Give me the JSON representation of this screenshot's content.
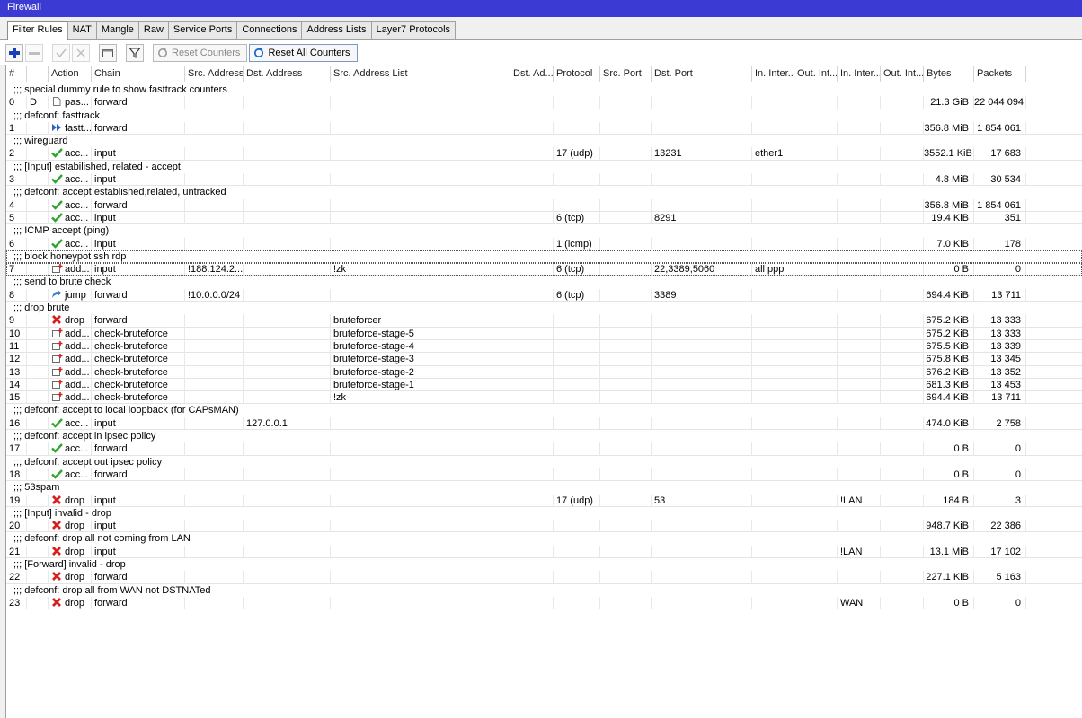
{
  "window": {
    "title": "Firewall"
  },
  "tabs": [
    {
      "label": "Filter Rules",
      "active": true
    },
    {
      "label": "NAT"
    },
    {
      "label": "Mangle"
    },
    {
      "label": "Raw"
    },
    {
      "label": "Service Ports"
    },
    {
      "label": "Connections"
    },
    {
      "label": "Address Lists"
    },
    {
      "label": "Layer7 Protocols"
    }
  ],
  "toolbar": {
    "icons": [
      "add-icon",
      "remove-icon",
      "enable-icon",
      "disable-icon",
      "comment-icon",
      "filter-icon"
    ],
    "reset_counters": "Reset Counters",
    "reset_all_counters": "Reset All Counters"
  },
  "columns": [
    "#",
    "",
    "Action",
    "Chain",
    "Src. Address",
    "Dst. Address",
    "Src. Address List",
    "Dst. Ad...",
    "Protocol",
    "Src. Port",
    "Dst. Port",
    "In. Inter...",
    "Out. Int...",
    "In. Inter...",
    "Out. Int...",
    "Bytes",
    "Packets"
  ],
  "rows": [
    {
      "comment": ";;; special dummy rule to show fasttrack counters"
    },
    {
      "num": "0",
      "flag": "D",
      "icon": "passthrough-icon",
      "action": "pas...",
      "chain": "forward",
      "bytes": "21.3 GiB",
      "packets": "22 044 094"
    },
    {
      "comment": ";;; defconf: fasttrack"
    },
    {
      "num": "1",
      "icon": "fasttrack-icon",
      "action": "fastt...",
      "chain": "forward",
      "bytes": "356.8 MiB",
      "packets": "1 854 061"
    },
    {
      "comment": ";;; wireguard"
    },
    {
      "num": "2",
      "icon": "accept-icon",
      "action": "acc...",
      "chain": "input",
      "proto": "17 (udp)",
      "dport": "13231",
      "inif": "ether1",
      "bytes": "3552.1 KiB",
      "packets": "17 683"
    },
    {
      "comment": ";;; [Input] estabilished, related - accept"
    },
    {
      "num": "3",
      "icon": "accept-icon",
      "action": "acc...",
      "chain": "input",
      "bytes": "4.8 MiB",
      "packets": "30 534"
    },
    {
      "comment": ";;; defconf: accept established,related, untracked"
    },
    {
      "num": "4",
      "icon": "accept-icon",
      "action": "acc...",
      "chain": "forward",
      "bytes": "356.8 MiB",
      "packets": "1 854 061"
    },
    {
      "num": "5",
      "icon": "accept-icon",
      "action": "acc...",
      "chain": "input",
      "proto": "6 (tcp)",
      "dport": "8291",
      "bytes": "19.4 KiB",
      "packets": "351"
    },
    {
      "comment": ";;; ICMP accept (ping)"
    },
    {
      "num": "6",
      "icon": "accept-icon",
      "action": "acc...",
      "chain": "input",
      "proto": "1 (icmp)",
      "bytes": "7.0 KiB",
      "packets": "178"
    },
    {
      "comment": ";;; block honeypot ssh rdp",
      "focus": true
    },
    {
      "num": "7",
      "icon": "add-to-list-icon",
      "action": "add...",
      "chain": "input",
      "src": "!188.124.2...",
      "srclist": "!zk",
      "proto": "6 (tcp)",
      "dport": "22,3389,5060",
      "inif": "all ppp",
      "bytes": "0 B",
      "packets": "0",
      "focus": true
    },
    {
      "comment": ";;; send to brute check"
    },
    {
      "num": "8",
      "icon": "jump-icon",
      "action": "jump",
      "chain": "forward",
      "src": "!10.0.0.0/24",
      "proto": "6 (tcp)",
      "dport": "3389",
      "bytes": "694.4 KiB",
      "packets": "13 711"
    },
    {
      "comment": ";;; drop brute"
    },
    {
      "num": "9",
      "icon": "drop-icon",
      "action": "drop",
      "chain": "forward",
      "srclist": "bruteforcer",
      "bytes": "675.2 KiB",
      "packets": "13 333"
    },
    {
      "num": "10",
      "icon": "add-to-list-icon",
      "action": "add...",
      "chain": "check-bruteforce",
      "srclist": "bruteforce-stage-5",
      "bytes": "675.2 KiB",
      "packets": "13 333"
    },
    {
      "num": "11",
      "icon": "add-to-list-icon",
      "action": "add...",
      "chain": "check-bruteforce",
      "srclist": "bruteforce-stage-4",
      "bytes": "675.5 KiB",
      "packets": "13 339"
    },
    {
      "num": "12",
      "icon": "add-to-list-icon",
      "action": "add...",
      "chain": "check-bruteforce",
      "srclist": "bruteforce-stage-3",
      "bytes": "675.8 KiB",
      "packets": "13 345"
    },
    {
      "num": "13",
      "icon": "add-to-list-icon",
      "action": "add...",
      "chain": "check-bruteforce",
      "srclist": "bruteforce-stage-2",
      "bytes": "676.2 KiB",
      "packets": "13 352"
    },
    {
      "num": "14",
      "icon": "add-to-list-icon",
      "action": "add...",
      "chain": "check-bruteforce",
      "srclist": "bruteforce-stage-1",
      "bytes": "681.3 KiB",
      "packets": "13 453"
    },
    {
      "num": "15",
      "icon": "add-to-list-icon",
      "action": "add...",
      "chain": "check-bruteforce",
      "srclist": "!zk",
      "bytes": "694.4 KiB",
      "packets": "13 711"
    },
    {
      "comment": ";;; defconf: accept to local loopback (for CAPsMAN)"
    },
    {
      "num": "16",
      "icon": "accept-icon",
      "action": "acc...",
      "chain": "input",
      "dst": "127.0.0.1",
      "bytes": "474.0 KiB",
      "packets": "2 758"
    },
    {
      "comment": ";;; defconf: accept in ipsec policy"
    },
    {
      "num": "17",
      "icon": "accept-icon",
      "action": "acc...",
      "chain": "forward",
      "bytes": "0 B",
      "packets": "0"
    },
    {
      "comment": ";;; defconf: accept out ipsec policy"
    },
    {
      "num": "18",
      "icon": "accept-icon",
      "action": "acc...",
      "chain": "forward",
      "bytes": "0 B",
      "packets": "0"
    },
    {
      "comment": ";;; 53spam"
    },
    {
      "num": "19",
      "icon": "drop-icon",
      "action": "drop",
      "chain": "input",
      "proto": "17 (udp)",
      "dport": "53",
      "inlist": "!LAN",
      "bytes": "184 B",
      "packets": "3"
    },
    {
      "comment": ";;; [Input] invalid - drop"
    },
    {
      "num": "20",
      "icon": "drop-icon",
      "action": "drop",
      "chain": "input",
      "bytes": "948.7 KiB",
      "packets": "22 386"
    },
    {
      "comment": ";;; defconf: drop all not coming from LAN"
    },
    {
      "num": "21",
      "icon": "drop-icon",
      "action": "drop",
      "chain": "input",
      "inlist": "!LAN",
      "bytes": "13.1 MiB",
      "packets": "17 102"
    },
    {
      "comment": ";;; [Forward] invalid - drop"
    },
    {
      "num": "22",
      "icon": "drop-icon",
      "action": "drop",
      "chain": "forward",
      "bytes": "227.1 KiB",
      "packets": "5 163"
    },
    {
      "comment": ";;; defconf: drop all from WAN not DSTNATed"
    },
    {
      "num": "23",
      "icon": "drop-icon",
      "action": "drop",
      "chain": "forward",
      "inlist": "WAN",
      "bytes": "0 B",
      "packets": "0"
    }
  ]
}
